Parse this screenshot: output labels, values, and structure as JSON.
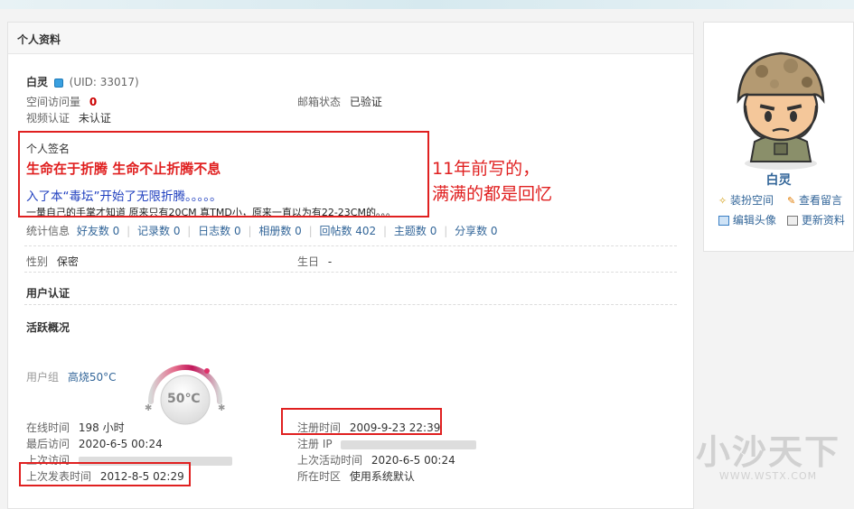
{
  "section_title": "个人资料",
  "profile": {
    "name": "白灵",
    "uid": "(UID: 33017)",
    "visits_label": "空间访问量",
    "visits_value": "0",
    "email_label": "邮箱状态",
    "email_value": "已验证",
    "video_label": "视频认证",
    "video_value": "未认证"
  },
  "signature": {
    "label": "个人签名",
    "line1": "生命在于折腾 生命不止折腾不息",
    "line2": "入了本“毒坛”开始了无限折腾。。。。。",
    "line3": "一量自己的手掌才知道 原来只有20CM 真TMD小，原来一直以为有22-23CM的。。。"
  },
  "annotation": {
    "line1": "11年前写的，",
    "line2": "满满的都是回忆"
  },
  "stats": {
    "label": "统计信息",
    "items": [
      "好友数 0",
      "记录数 0",
      "日志数 0",
      "相册数 0",
      "回帖数 402",
      "主题数 0",
      "分享数 0"
    ]
  },
  "basic": {
    "gender_label": "性别",
    "gender_value": "保密",
    "birthday_label": "生日",
    "birthday_value": "-"
  },
  "auth_title": "用户认证",
  "activity": {
    "title": "活跃概况",
    "group_label": "用户组",
    "group_value": "高烧50°C",
    "gauge_text": "50℃",
    "online_label": "在线时间",
    "online_value": "198 小时",
    "register_label": "注册时间",
    "register_value": "2009-9-23 22:39",
    "last_visit_label": "最后访问",
    "last_visit_value": "2020-6-5 00:24",
    "reg_ip_label": "注册 IP",
    "last_visit_ip_label": "上次访问",
    "last_active_label": "上次活动时间",
    "last_active_value": "2020-6-5 00:24",
    "last_post_label": "上次发表时间",
    "last_post_value": "2012-8-5 02:29",
    "timezone_label": "所在时区",
    "timezone_value": "使用系统默认"
  },
  "sidebar": {
    "name": "白灵",
    "actions": [
      "装扮空间",
      "查看留言",
      "编辑头像",
      "更新资料"
    ]
  },
  "watermark": {
    "brand": "小沙天下",
    "url": "WWW.WSTX.COM"
  }
}
